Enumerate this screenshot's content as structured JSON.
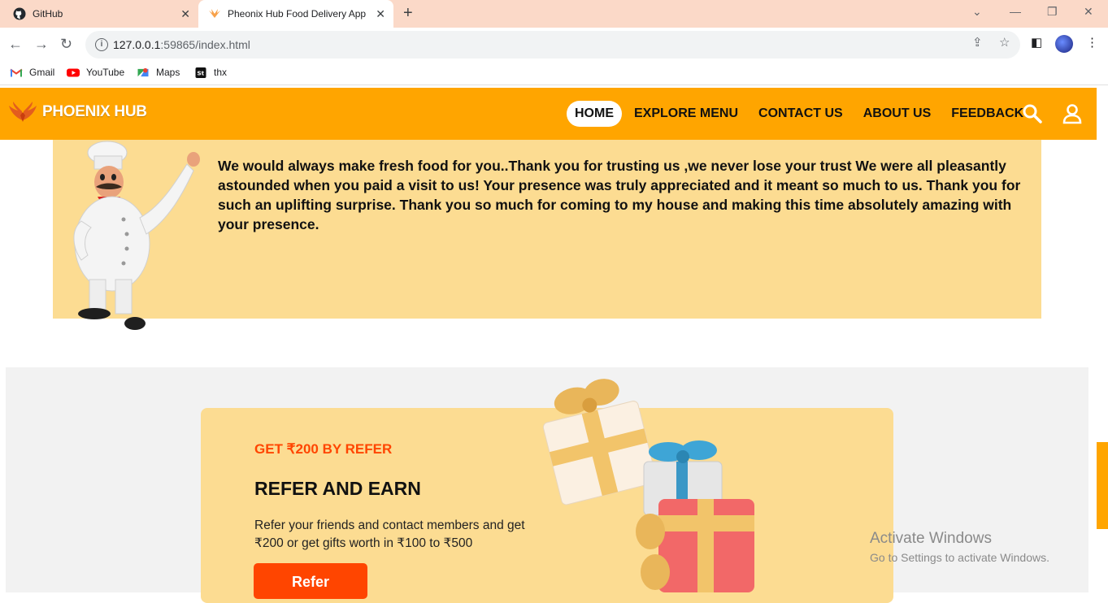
{
  "browser": {
    "tabs": [
      {
        "title": "GitHub",
        "active": false
      },
      {
        "title": "Pheonix Hub Food Delivery App",
        "active": true
      }
    ],
    "url": {
      "host": "127.0.0.1",
      "path": ":59865/index.html"
    },
    "bookmarks": [
      {
        "label": "Gmail",
        "icon": "gmail-icon"
      },
      {
        "label": "YouTube",
        "icon": "youtube-icon"
      },
      {
        "label": "Maps",
        "icon": "maps-icon"
      },
      {
        "label": "thx",
        "icon": "st-icon"
      }
    ]
  },
  "site": {
    "brand": "PHOENIX HUB",
    "nav": [
      {
        "label": "HOME",
        "active": true
      },
      {
        "label": "EXPLORE MENU",
        "active": false
      },
      {
        "label": "CONTACT US",
        "active": false
      },
      {
        "label": "ABOUT US",
        "active": false
      },
      {
        "label": "FEEDBACK",
        "active": false
      }
    ],
    "colors": {
      "header": "#ffa500",
      "accent": "#ff4500",
      "panel": "#fcdc92"
    }
  },
  "chef_section": {
    "text": "We would always make fresh food for you..Thank you for trusting us ,we never lose your trust We were all pleasantly astounded when you paid a visit to us! Your presence was truly appreciated and it meant so much to us. Thank you for such an uplifting surprise. Thank you so much for coming to my house and making this time absolutely amazing with your presence."
  },
  "refer_section": {
    "kicker": "GET ₹200 BY REFER",
    "title": "REFER AND EARN",
    "description": "Refer your friends and contact members and get ₹200 or get gifts worth in ₹100 to ₹500",
    "button": "Refer"
  },
  "watermark": {
    "line1": "Activate Windows",
    "line2": "Go to Settings to activate Windows."
  }
}
